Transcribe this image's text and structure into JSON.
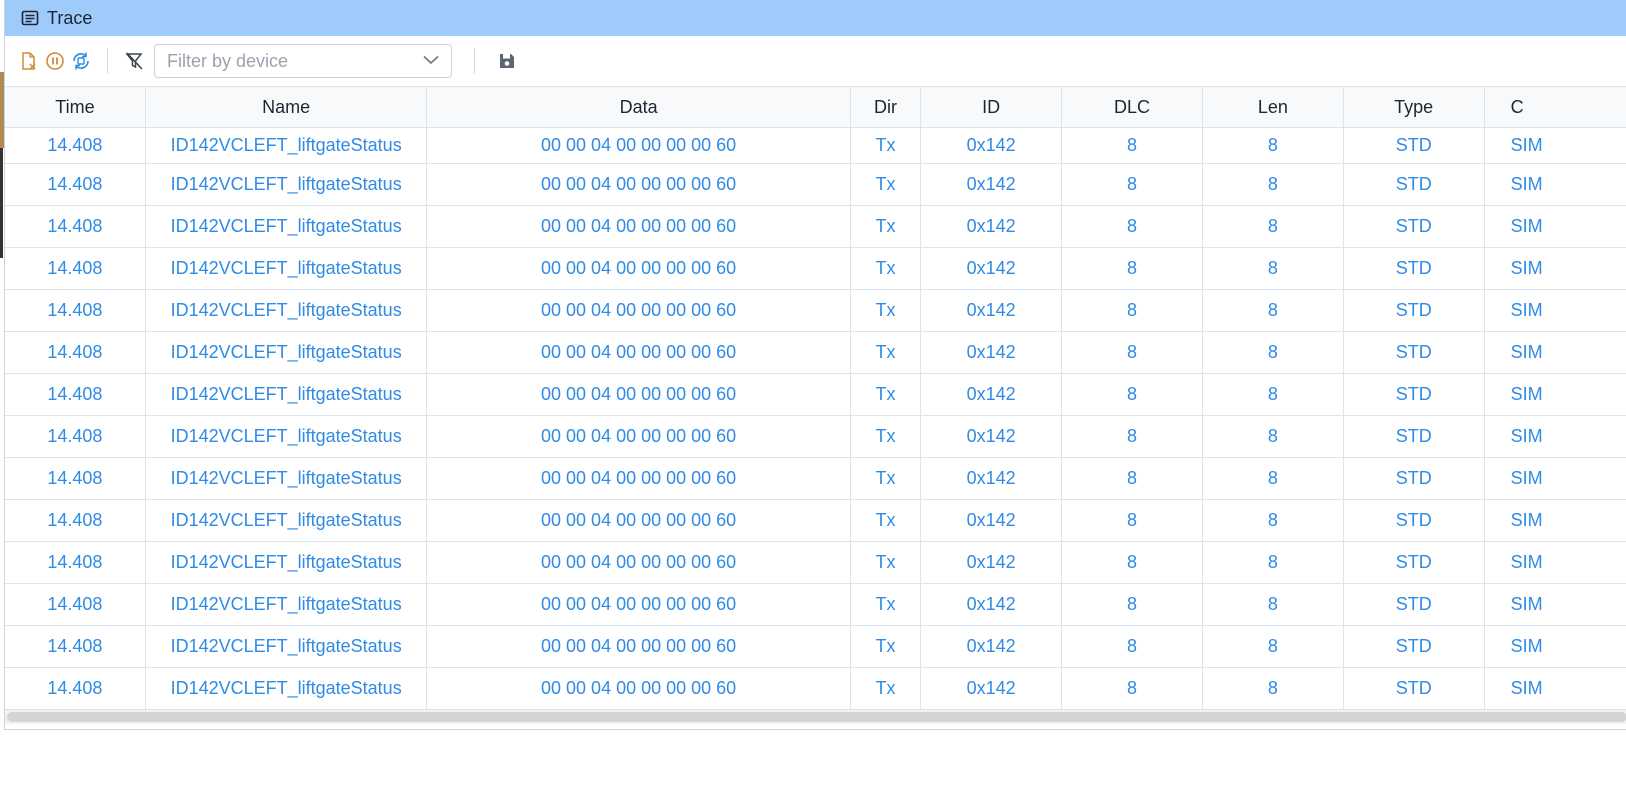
{
  "window": {
    "title": "Trace",
    "title_icon": "list-icon"
  },
  "toolbar": {
    "clear_icon": "clear-file-icon",
    "pause_icon": "pause-circle-icon",
    "autoscroll_icon": "sync-scroll-icon",
    "filter_clear_icon": "filter-clear-icon",
    "device_filter": {
      "placeholder": "Filter by device",
      "value": ""
    },
    "save_icon": "save-icon"
  },
  "colors": {
    "titlebar": "#9fcbfb",
    "cell_text": "#2f8be6",
    "header_bg": "#f7f9fb"
  },
  "columns": [
    "Time",
    "Name",
    "Data",
    "Dir",
    "ID",
    "DLC",
    "Len",
    "Type",
    "C"
  ],
  "rows": [
    {
      "time": "14.408",
      "name": "ID142VCLEFT_liftgateStatus",
      "data": "00 00 04 00 00 00 00 60",
      "dir": "Tx",
      "id": "0x142",
      "dlc": "8",
      "len": "8",
      "type": "STD",
      "ch": "SIM"
    },
    {
      "time": "14.408",
      "name": "ID142VCLEFT_liftgateStatus",
      "data": "00 00 04 00 00 00 00 60",
      "dir": "Tx",
      "id": "0x142",
      "dlc": "8",
      "len": "8",
      "type": "STD",
      "ch": "SIM"
    },
    {
      "time": "14.408",
      "name": "ID142VCLEFT_liftgateStatus",
      "data": "00 00 04 00 00 00 00 60",
      "dir": "Tx",
      "id": "0x142",
      "dlc": "8",
      "len": "8",
      "type": "STD",
      "ch": "SIM"
    },
    {
      "time": "14.408",
      "name": "ID142VCLEFT_liftgateStatus",
      "data": "00 00 04 00 00 00 00 60",
      "dir": "Tx",
      "id": "0x142",
      "dlc": "8",
      "len": "8",
      "type": "STD",
      "ch": "SIM"
    },
    {
      "time": "14.408",
      "name": "ID142VCLEFT_liftgateStatus",
      "data": "00 00 04 00 00 00 00 60",
      "dir": "Tx",
      "id": "0x142",
      "dlc": "8",
      "len": "8",
      "type": "STD",
      "ch": "SIM"
    },
    {
      "time": "14.408",
      "name": "ID142VCLEFT_liftgateStatus",
      "data": "00 00 04 00 00 00 00 60",
      "dir": "Tx",
      "id": "0x142",
      "dlc": "8",
      "len": "8",
      "type": "STD",
      "ch": "SIM"
    },
    {
      "time": "14.408",
      "name": "ID142VCLEFT_liftgateStatus",
      "data": "00 00 04 00 00 00 00 60",
      "dir": "Tx",
      "id": "0x142",
      "dlc": "8",
      "len": "8",
      "type": "STD",
      "ch": "SIM"
    },
    {
      "time": "14.408",
      "name": "ID142VCLEFT_liftgateStatus",
      "data": "00 00 04 00 00 00 00 60",
      "dir": "Tx",
      "id": "0x142",
      "dlc": "8",
      "len": "8",
      "type": "STD",
      "ch": "SIM"
    },
    {
      "time": "14.408",
      "name": "ID142VCLEFT_liftgateStatus",
      "data": "00 00 04 00 00 00 00 60",
      "dir": "Tx",
      "id": "0x142",
      "dlc": "8",
      "len": "8",
      "type": "STD",
      "ch": "SIM"
    },
    {
      "time": "14.408",
      "name": "ID142VCLEFT_liftgateStatus",
      "data": "00 00 04 00 00 00 00 60",
      "dir": "Tx",
      "id": "0x142",
      "dlc": "8",
      "len": "8",
      "type": "STD",
      "ch": "SIM"
    },
    {
      "time": "14.408",
      "name": "ID142VCLEFT_liftgateStatus",
      "data": "00 00 04 00 00 00 00 60",
      "dir": "Tx",
      "id": "0x142",
      "dlc": "8",
      "len": "8",
      "type": "STD",
      "ch": "SIM"
    },
    {
      "time": "14.408",
      "name": "ID142VCLEFT_liftgateStatus",
      "data": "00 00 04 00 00 00 00 60",
      "dir": "Tx",
      "id": "0x142",
      "dlc": "8",
      "len": "8",
      "type": "STD",
      "ch": "SIM"
    },
    {
      "time": "14.408",
      "name": "ID142VCLEFT_liftgateStatus",
      "data": "00 00 04 00 00 00 00 60",
      "dir": "Tx",
      "id": "0x142",
      "dlc": "8",
      "len": "8",
      "type": "STD",
      "ch": "SIM"
    },
    {
      "time": "14.408",
      "name": "ID142VCLEFT_liftgateStatus",
      "data": "00 00 04 00 00 00 00 60",
      "dir": "Tx",
      "id": "0x142",
      "dlc": "8",
      "len": "8",
      "type": "STD",
      "ch": "SIM"
    }
  ]
}
